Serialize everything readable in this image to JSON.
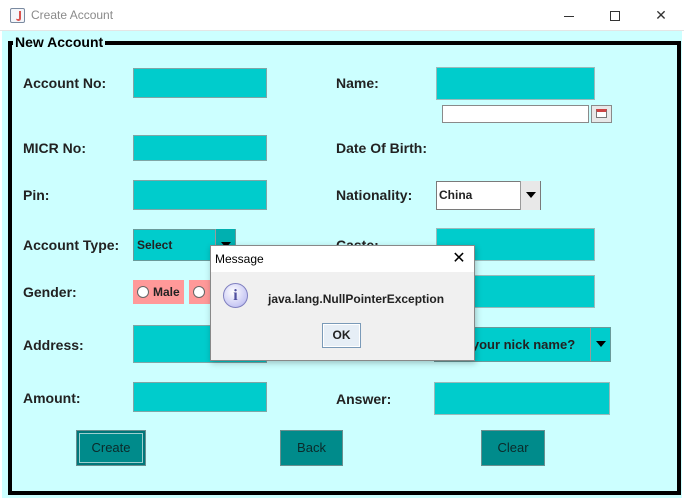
{
  "window": {
    "title": "Create Account",
    "controls": {
      "minimize": "",
      "maximize": "",
      "close": "✕"
    }
  },
  "form": {
    "legend": "New Account",
    "labels": {
      "account_no": "Account No:",
      "name": "Name:",
      "micr_no": "MICR No:",
      "date_of_birth": "Date Of Birth:",
      "pin": "Pin:",
      "nationality": "Nationality:",
      "account_type": "Account Type:",
      "caste": "Caste:",
      "gender": "Gender:",
      "address": "Address:",
      "amount": "Amount:",
      "answer": "Answer:"
    },
    "values": {
      "account_no": "",
      "name": "",
      "micr_no": "",
      "date_of_birth": "",
      "pin": "",
      "caste": "",
      "address": "",
      "amount": "",
      "answer": "",
      "extra_field": ""
    },
    "combos": {
      "nationality": "China",
      "account_type": "Select",
      "security_question": "What is your nick name?"
    },
    "gender_options": {
      "male": "Male",
      "female": ""
    },
    "buttons": {
      "create": "Create",
      "back": "Back",
      "clear": "Clear"
    }
  },
  "dialog": {
    "title": "Message",
    "close": "✕",
    "icon_text": "i",
    "message": "java.lang.NullPointerException",
    "ok": "OK"
  },
  "colors": {
    "panel_background": "#ccffff",
    "field": "#00cccc",
    "button": "#008b8b",
    "radio_background": "#ff9999"
  }
}
